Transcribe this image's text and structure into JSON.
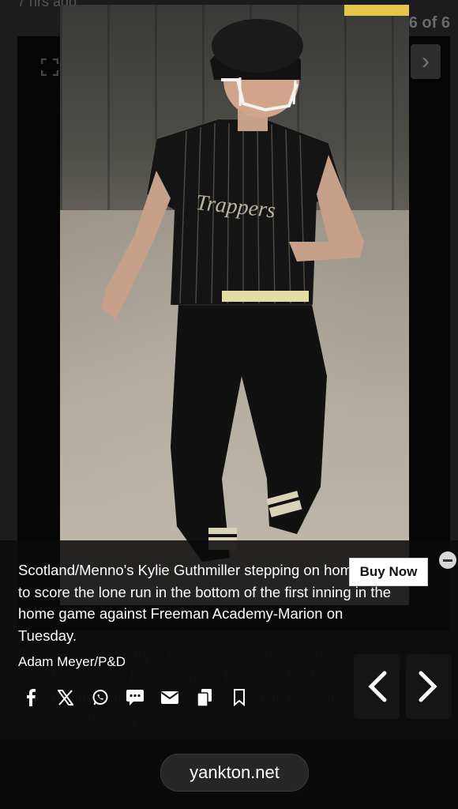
{
  "background": {
    "top_text": "7 hrs ago",
    "counter": "6 of 6",
    "next_glyph": "›"
  },
  "photo": {
    "jersey_text": "Trappers"
  },
  "caption": {
    "text": "Scotland/Menno's Kylie Guthmiller stepping on home plate to score the lone run in the bottom of the first inning in the home game against Freeman Academy-Marion on Tuesday.",
    "credit": "Adam Meyer/P&D",
    "buy_label": "Buy Now"
  },
  "share_icons": [
    "facebook-icon",
    "x-icon",
    "whatsapp-icon",
    "sms-icon",
    "email-icon",
    "copy-icon",
    "bookmark-icon"
  ],
  "footer": {
    "url": "yankton.net"
  },
  "colors": {
    "overlay": "#0a0a0a",
    "button_bg": "#ffffff",
    "accent_yellow": "#e5c64d"
  }
}
